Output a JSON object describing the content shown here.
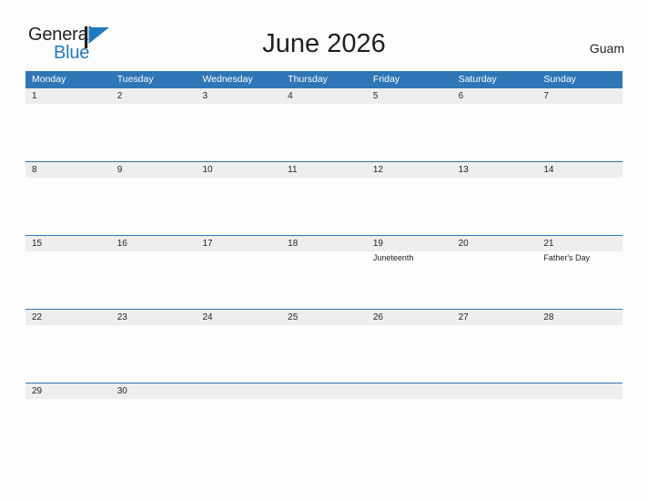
{
  "brand": {
    "name_part1": "General",
    "name_part2": "Blue",
    "mark_icon": "blue-flag-triangle-icon",
    "accent_color": "#1f7ac4"
  },
  "header": {
    "title": "June 2026",
    "region": "Guam"
  },
  "calendar": {
    "header_bg_color": "#2f76b6",
    "daynum_band_color": "#eeeeee",
    "weekday_headers": [
      "Monday",
      "Tuesday",
      "Wednesday",
      "Thursday",
      "Friday",
      "Saturday",
      "Sunday"
    ],
    "weeks": [
      {
        "days": [
          {
            "num": "1",
            "events": []
          },
          {
            "num": "2",
            "events": []
          },
          {
            "num": "3",
            "events": []
          },
          {
            "num": "4",
            "events": []
          },
          {
            "num": "5",
            "events": []
          },
          {
            "num": "6",
            "events": []
          },
          {
            "num": "7",
            "events": []
          }
        ]
      },
      {
        "days": [
          {
            "num": "8",
            "events": []
          },
          {
            "num": "9",
            "events": []
          },
          {
            "num": "10",
            "events": []
          },
          {
            "num": "11",
            "events": []
          },
          {
            "num": "12",
            "events": []
          },
          {
            "num": "13",
            "events": []
          },
          {
            "num": "14",
            "events": []
          }
        ]
      },
      {
        "days": [
          {
            "num": "15",
            "events": []
          },
          {
            "num": "16",
            "events": []
          },
          {
            "num": "17",
            "events": []
          },
          {
            "num": "18",
            "events": []
          },
          {
            "num": "19",
            "events": [
              "Juneteenth"
            ]
          },
          {
            "num": "20",
            "events": []
          },
          {
            "num": "21",
            "events": [
              "Father's Day"
            ]
          }
        ]
      },
      {
        "days": [
          {
            "num": "22",
            "events": []
          },
          {
            "num": "23",
            "events": []
          },
          {
            "num": "24",
            "events": []
          },
          {
            "num": "25",
            "events": []
          },
          {
            "num": "26",
            "events": []
          },
          {
            "num": "27",
            "events": []
          },
          {
            "num": "28",
            "events": []
          }
        ]
      },
      {
        "days": [
          {
            "num": "29",
            "events": []
          },
          {
            "num": "30",
            "events": []
          },
          {
            "num": "",
            "events": []
          },
          {
            "num": "",
            "events": []
          },
          {
            "num": "",
            "events": []
          },
          {
            "num": "",
            "events": []
          },
          {
            "num": "",
            "events": []
          }
        ]
      }
    ]
  }
}
